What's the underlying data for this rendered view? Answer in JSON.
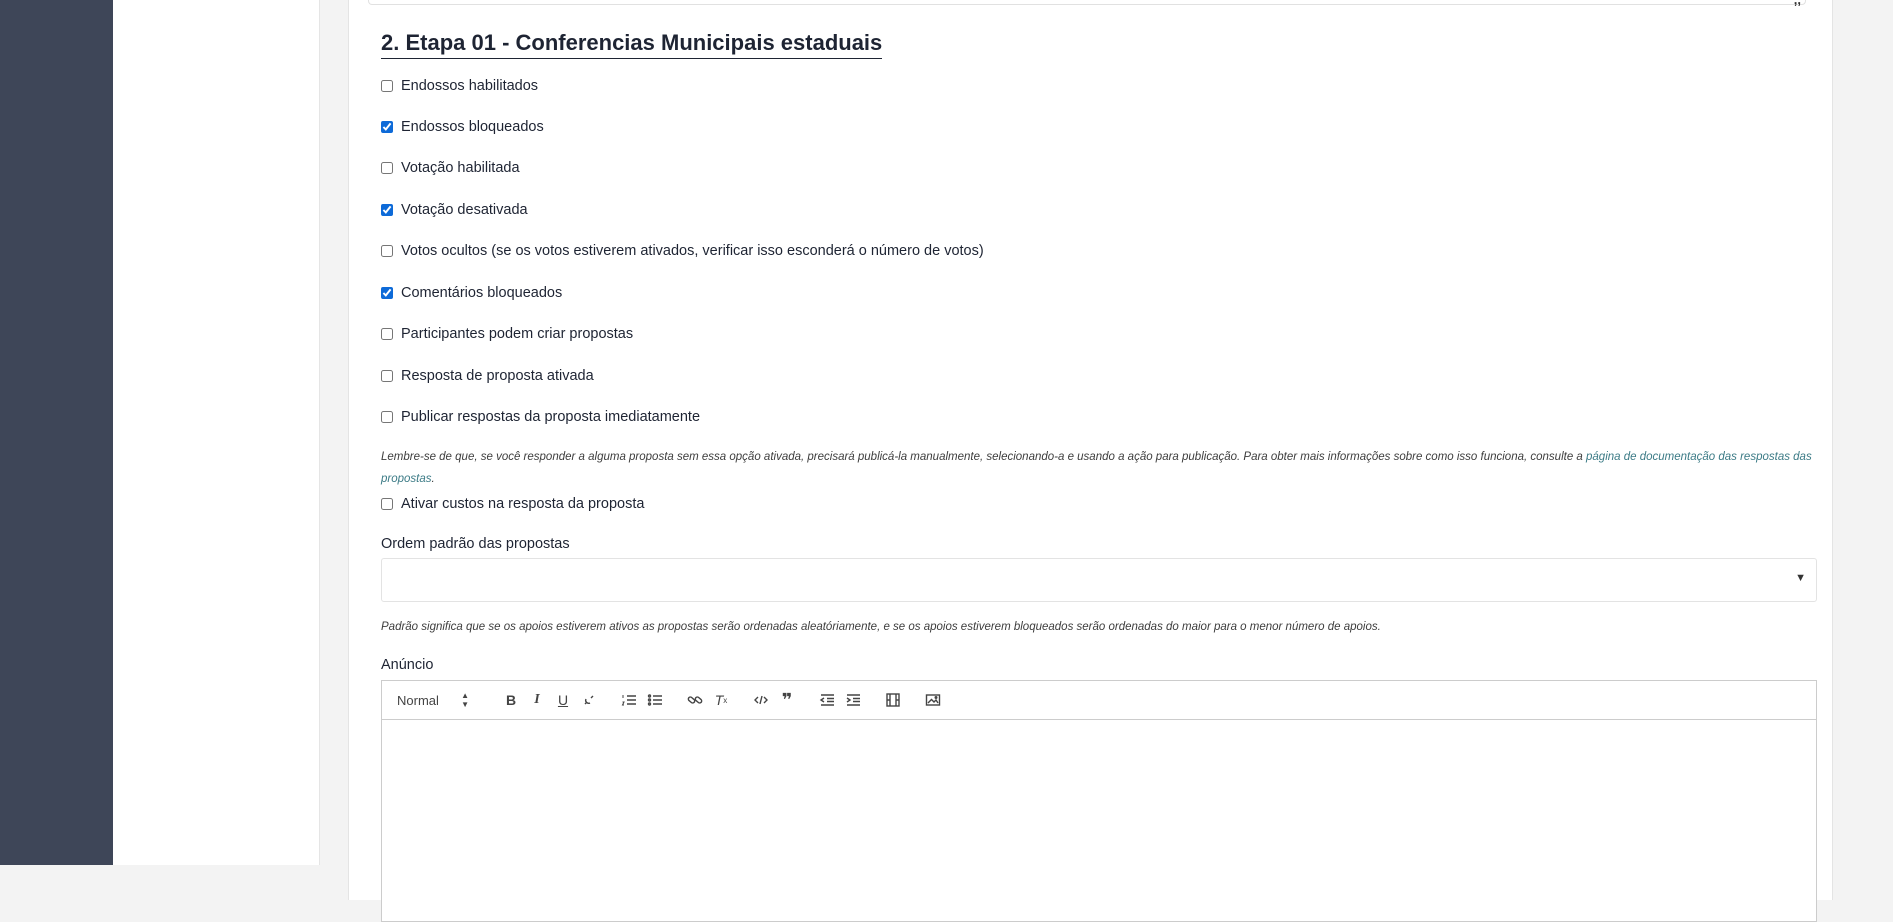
{
  "section": {
    "title": "2. Etapa 01 - Conferencias Municipais estaduais"
  },
  "options": [
    {
      "label": "Endossos habilitados",
      "checked": false
    },
    {
      "label": "Endossos bloqueados",
      "checked": true
    },
    {
      "label": "Votação habilitada",
      "checked": false
    },
    {
      "label": "Votação desativada",
      "checked": true
    },
    {
      "label": "Votos ocultos (se os votos estiverem ativados, verificar isso esconderá o número de votos)",
      "checked": false
    },
    {
      "label": "Comentários bloqueados",
      "checked": true
    },
    {
      "label": "Participantes podem criar propostas",
      "checked": false
    },
    {
      "label": "Resposta de proposta ativada",
      "checked": false
    },
    {
      "label": "Publicar respostas da proposta imediatamente",
      "checked": false
    }
  ],
  "publish_help": {
    "text": "Lembre-se de que, se você responder a alguma proposta sem essa opção ativada, precisará publicá-la manualmente, selecionando-a e usando a ação para publicação. Para obter mais informações sobre como isso funciona, consulte a ",
    "link": "página de documentação das respostas das propostas",
    "suffix": "."
  },
  "costs_option": {
    "label": "Ativar custos na resposta da proposta",
    "checked": false
  },
  "default_order": {
    "label": "Ordem padrão das propostas",
    "value": "",
    "caret": "▼",
    "help": "Padrão significa que se os apoios estiverem ativos as propostas serão ordenadas aleatóriamente, e se os apoios estiverem bloqueados serão ordenadas do maior para o menor número de apoios."
  },
  "announcement": {
    "label": "Anúncio",
    "content": "",
    "toolbar": {
      "format_label": "Normal",
      "icons": [
        "bold-icon",
        "italic-icon",
        "underline-icon",
        "unlink-icon",
        "ordered-list-icon",
        "bullet-list-icon",
        "link-icon",
        "clear-format-icon",
        "code-icon",
        "blockquote-icon",
        "outdent-icon",
        "indent-icon",
        "video-icon",
        "image-icon"
      ]
    }
  },
  "colors": {
    "nav_rail": "#3e4658",
    "link": "#3c7b86",
    "checkbox_accent": "#0d6ad8",
    "heading": "#1e2433"
  }
}
